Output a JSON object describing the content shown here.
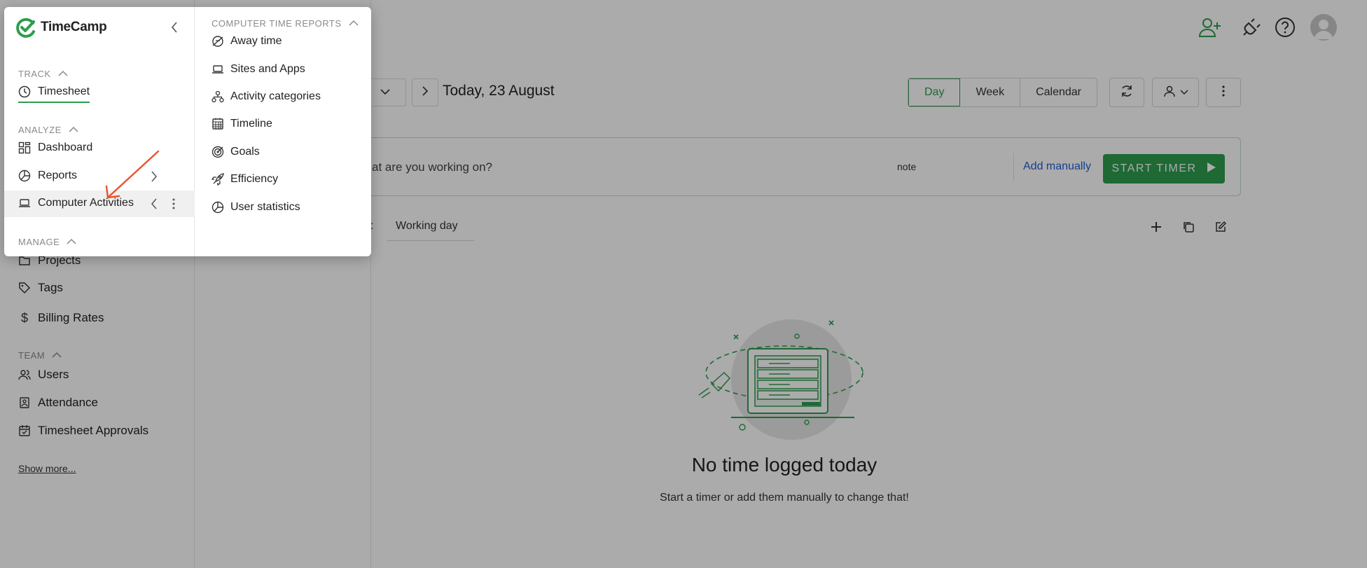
{
  "app": {
    "logo_text": "TimeCamp",
    "brand_color": "#2e9d4e",
    "annotation_color": "#e8542a"
  },
  "sidebar": {
    "behind_items": [
      {
        "label": "Projects",
        "icon": "folder-icon"
      },
      {
        "label": "Tags",
        "icon": "tag-icon"
      },
      {
        "label": "Billing Rates",
        "icon": "dollar-icon"
      }
    ],
    "team_section": "TEAM",
    "team_items": [
      {
        "label": "Users",
        "icon": "users-icon"
      },
      {
        "label": "Attendance",
        "icon": "attendance-icon"
      },
      {
        "label": "Timesheet Approvals",
        "icon": "calendar-check-icon"
      }
    ],
    "show_more": "Show more..."
  },
  "popup": {
    "track_section": "TRACK",
    "track_items": [
      {
        "label": "Timesheet",
        "icon": "clock-icon"
      }
    ],
    "analyze_section": "ANALYZE",
    "analyze_items": [
      {
        "label": "Dashboard",
        "icon": "dashboard-icon"
      },
      {
        "label": "Reports",
        "icon": "pie-chart-icon"
      },
      {
        "label": "Computer Activities",
        "icon": "laptop-icon"
      }
    ],
    "manage_section": "MANAGE",
    "reports_section": "COMPUTER TIME REPORTS",
    "reports_items": [
      {
        "label": "Away time",
        "icon": "away-icon"
      },
      {
        "label": "Sites and Apps",
        "icon": "laptop-icon"
      },
      {
        "label": "Activity categories",
        "icon": "hierarchy-icon"
      },
      {
        "label": "Timeline",
        "icon": "calendar-grid-icon"
      },
      {
        "label": "Goals",
        "icon": "target-icon"
      },
      {
        "label": "Efficiency",
        "icon": "rocket-icon"
      },
      {
        "label": "User statistics",
        "icon": "pie-chart-icon"
      }
    ]
  },
  "header": {
    "date_title": "Today, 23 August",
    "views": [
      "Day",
      "Week",
      "Calendar"
    ],
    "active_view": "Day"
  },
  "timer": {
    "placeholder": "at are you working on?",
    "note_label": "note",
    "add_manually": "Add manually",
    "start_timer": "START TIMER"
  },
  "type_row": {
    "label": "e:",
    "value": "Working day"
  },
  "empty_state": {
    "title": "No time logged today",
    "subtitle": "Start a timer or add them manually to change that!"
  }
}
